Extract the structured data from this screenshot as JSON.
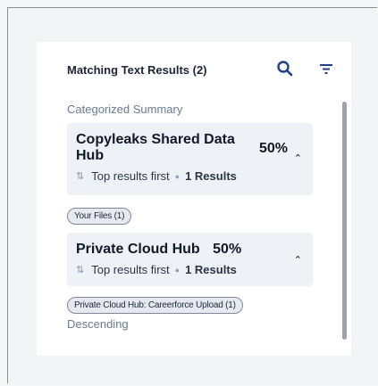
{
  "panel": {
    "title": "Matching Text Results (2)",
    "icons": {
      "search": "search-icon",
      "filter": "filter-icon"
    }
  },
  "sections": [
    {
      "label": "Categorized Summary"
    },
    {
      "label": "Descending"
    }
  ],
  "groups": [
    {
      "title_line1": "Copyleaks Shared Data",
      "title_line2": "Hub",
      "percent": "50%",
      "sort_label": "Top results first",
      "results": "1 Results",
      "chip": "Your Files (1)"
    },
    {
      "title_line1": "Private Cloud Hub",
      "percent": "50%",
      "sort_label": "Top results first",
      "results": "1 Results",
      "chip": "Private Cloud Hub: Careerforce Upload (1)"
    }
  ],
  "colors": {
    "accent": "#1f3f8a",
    "card_bg": "#eef2f6",
    "muted": "#6b7a90"
  }
}
